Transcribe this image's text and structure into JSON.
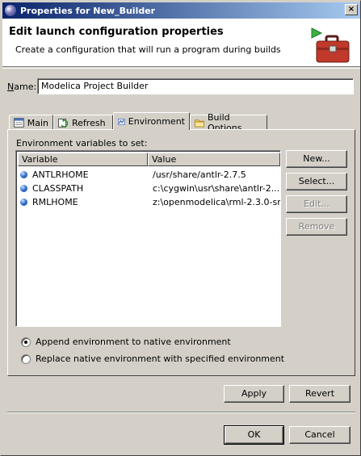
{
  "window": {
    "title": "Properties for New_Builder"
  },
  "banner": {
    "heading": "Edit launch configuration properties",
    "description": "Create a configuration that will run a program during builds"
  },
  "name": {
    "label": "Name:",
    "value": "Modelica Project Builder"
  },
  "tabs": [
    {
      "label": "Main"
    },
    {
      "label": "Refresh"
    },
    {
      "label": "Environment"
    },
    {
      "label": "Build Options"
    }
  ],
  "environment": {
    "label": "Environment variables to set:",
    "columns": [
      "Variable",
      "Value"
    ],
    "rows": [
      {
        "variable": "ANTLRHOME",
        "value": "/usr/share/antlr-2.7.5"
      },
      {
        "variable": "CLASSPATH",
        "value": "c:\\cygwin\\usr\\share\\antlr-2...."
      },
      {
        "variable": "RMLHOME",
        "value": "z:\\openmodelica\\rml-2.3.0-sr..."
      }
    ],
    "buttons": {
      "new": "New...",
      "select": "Select...",
      "edit": "Edit...",
      "remove": "Remove"
    },
    "append_label": "Append environment to native environment",
    "replace_label": "Replace native environment with specified environment",
    "selected_mode": "append"
  },
  "footer": {
    "apply": "Apply",
    "revert": "Revert",
    "ok": "OK",
    "cancel": "Cancel"
  }
}
